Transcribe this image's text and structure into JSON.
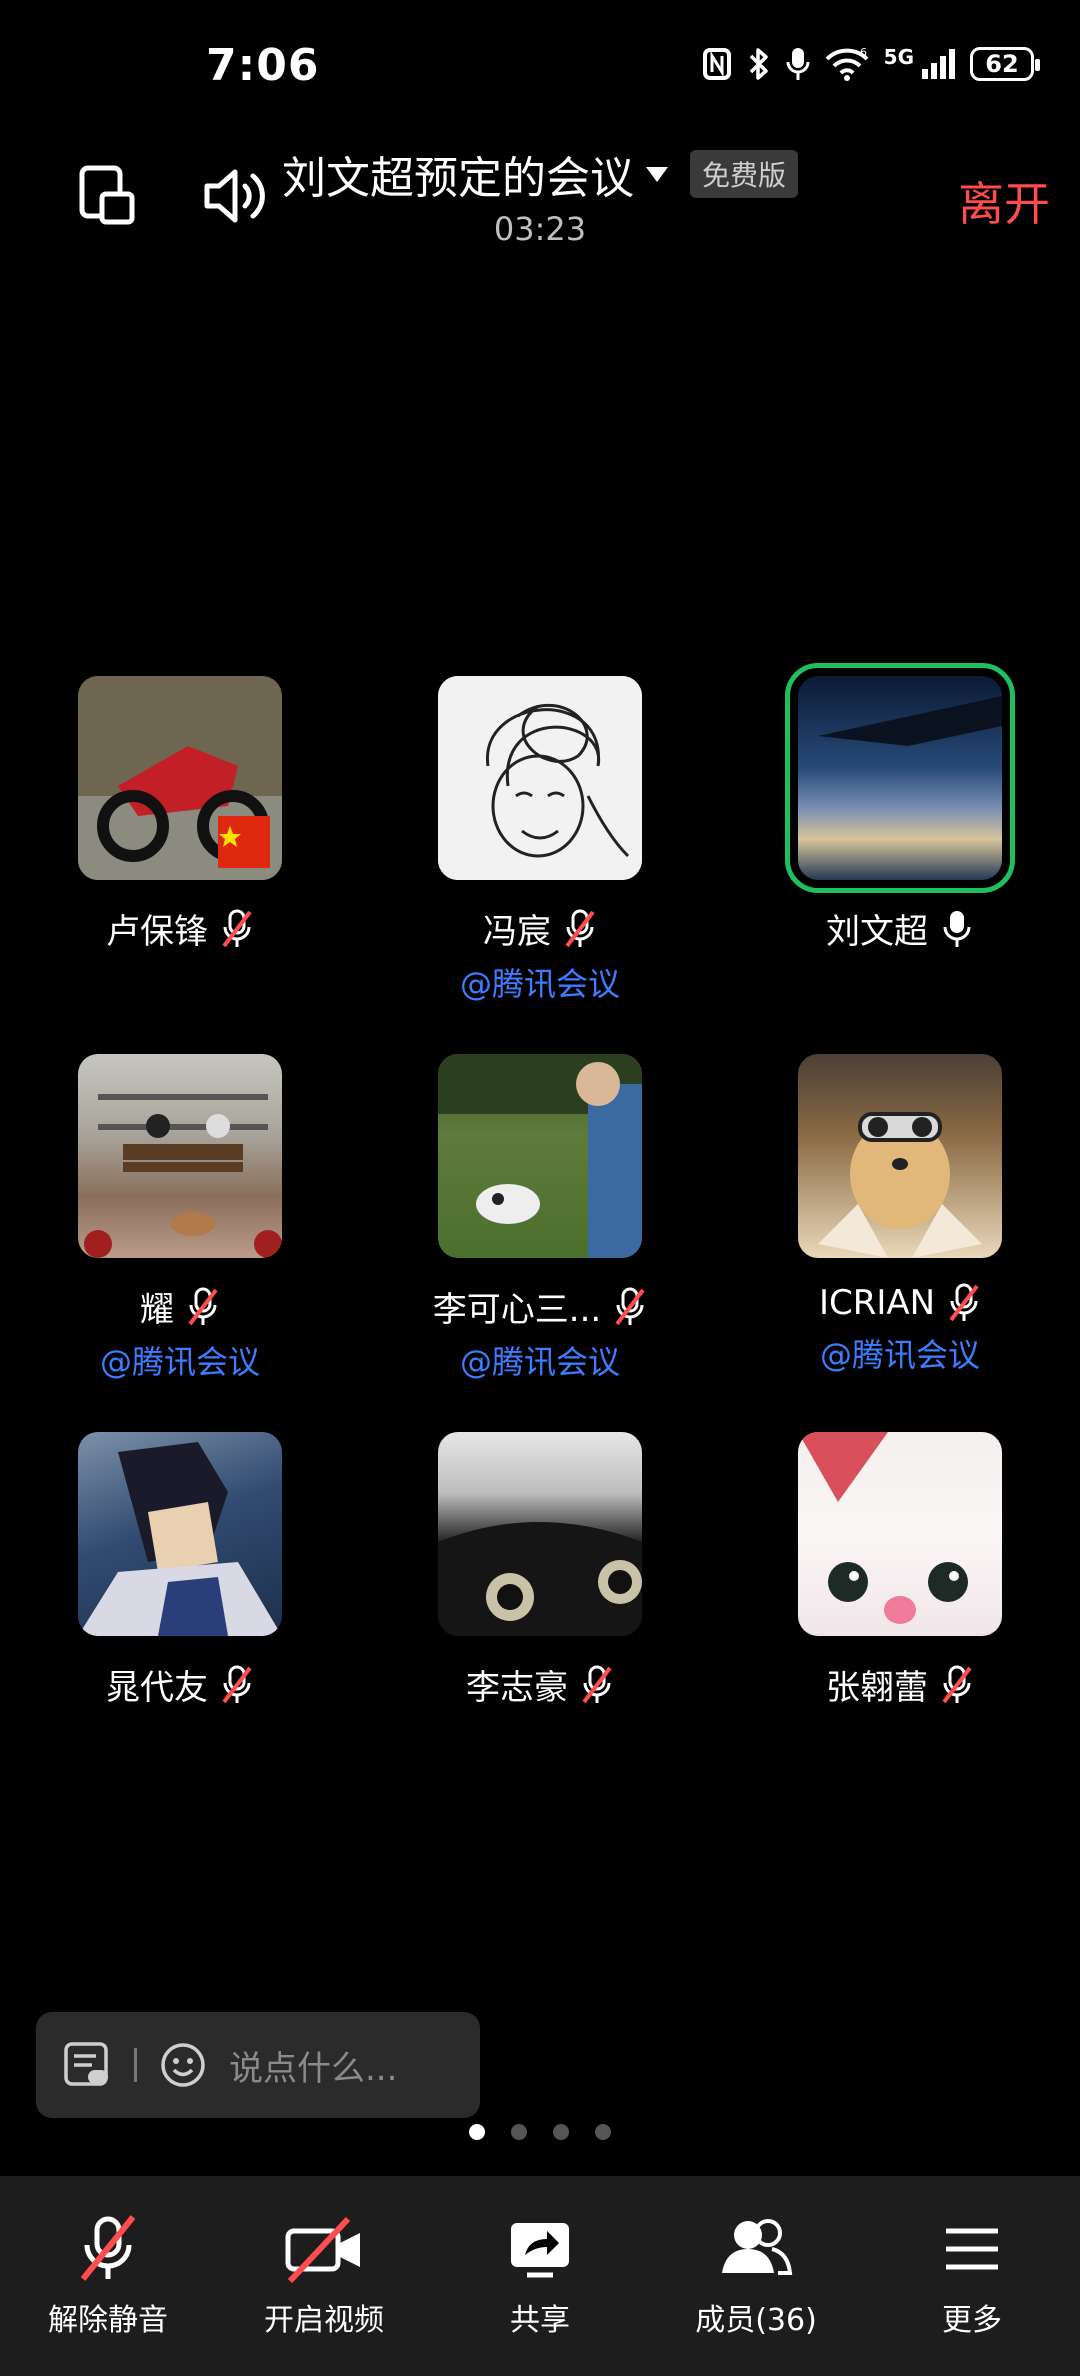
{
  "status": {
    "time": "7:06",
    "battery": "62",
    "network": "5G"
  },
  "header": {
    "title": "刘文超预定的会议",
    "badge": "免费版",
    "timer": "03:23",
    "leave": "离开"
  },
  "participants": [
    {
      "name": "卢保锋",
      "sub": "",
      "mic": "muted"
    },
    {
      "name": "冯宸",
      "sub": "@腾讯会议",
      "mic": "muted"
    },
    {
      "name": "刘文超",
      "sub": "",
      "mic": "on"
    },
    {
      "name": "耀",
      "sub": "@腾讯会议",
      "mic": "muted"
    },
    {
      "name": "李可心三...",
      "sub": "@腾讯会议",
      "mic": "muted"
    },
    {
      "name": "ICRIAN",
      "sub": "@腾讯会议",
      "mic": "muted"
    },
    {
      "name": "晁代友",
      "sub": "",
      "mic": "muted"
    },
    {
      "name": "李志豪",
      "sub": "",
      "mic": "muted"
    },
    {
      "name": "张翱蕾",
      "sub": "",
      "mic": "muted"
    }
  ],
  "chat": {
    "placeholder": "说点什么..."
  },
  "pager": {
    "pages": 4,
    "current": 1
  },
  "toolbar": {
    "unmute": "解除静音",
    "video": "开启视频",
    "share": "共享",
    "members": "成员(36)",
    "more": "更多"
  },
  "colors": {
    "leave": "#ff4d4f",
    "link": "#3d7cff",
    "active_border": "#1fbf5f"
  }
}
